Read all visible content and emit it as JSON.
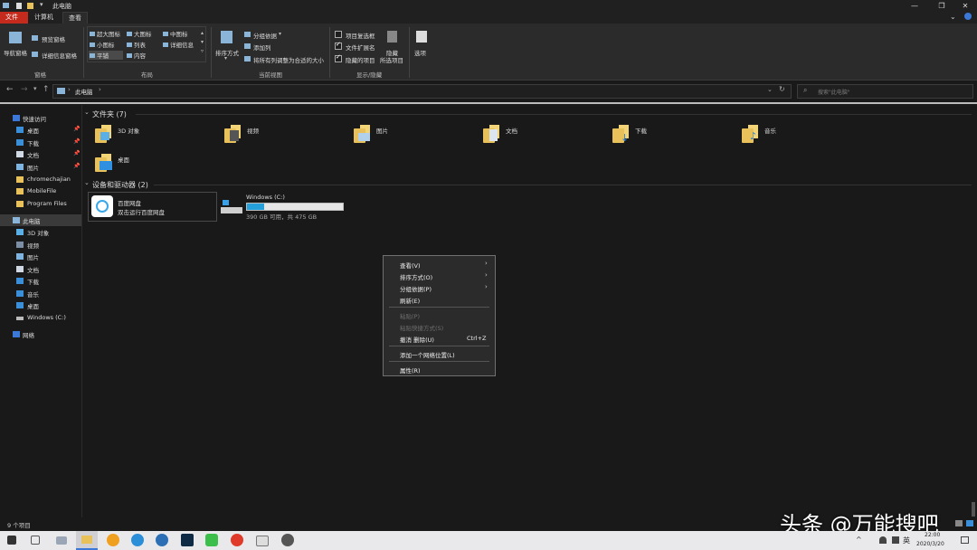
{
  "window": {
    "title": "此电脑"
  },
  "tabs": [
    "文件",
    "计算机",
    "查看"
  ],
  "ribbon": {
    "pane": {
      "nav_pane": "导航窗格",
      "preview": "预览窗格",
      "details": "详细信息窗格",
      "group": "窗格"
    },
    "layout": {
      "items": [
        "超大图标",
        "大图标",
        "中图标",
        "小图标",
        "列表",
        "详细信息",
        "平铺",
        "内容"
      ],
      "group": "布局"
    },
    "current_view": {
      "sort": "排序方式",
      "group_by": "分组依据",
      "add_col": "添加列",
      "fit_cols": "将所有列调整为合适的大小",
      "group": "当前视图"
    },
    "show_hide": {
      "item_cb": "项目复选框",
      "ext": "文件扩展名",
      "hidden": "隐藏的项目",
      "hide_sel": "隐藏",
      "hide_sel2": "所选项目",
      "group": "显示/隐藏"
    },
    "options": "选项"
  },
  "address": {
    "path": "此电脑",
    "search_placeholder": "搜索\"此电脑\""
  },
  "nav": {
    "quick_access": "快速访问",
    "quick_items": [
      "桌面",
      "下载",
      "文档",
      "图片",
      "chromechajian",
      "MobileFile",
      "Program Files"
    ],
    "this_pc": "此电脑",
    "pc_items": [
      "3D 对象",
      "视频",
      "图片",
      "文档",
      "下载",
      "音乐",
      "桌面",
      "Windows (C:)"
    ],
    "network": "网络"
  },
  "folders": {
    "header": "文件夹 (7)",
    "items": [
      "3D 对象",
      "视频",
      "图片",
      "文档",
      "下载",
      "音乐",
      "桌面"
    ]
  },
  "drives": {
    "header": "设备和驱动器 (2)",
    "baidu": {
      "name": "百度网盘",
      "desc": "双击运行百度网盘"
    },
    "c": {
      "name": "Windows (C:)",
      "info": "390 GB 可用，共 475 GB",
      "used_fraction": 0.18
    }
  },
  "context_menu": {
    "items": [
      "查看(V)",
      "排序方式(O)",
      "分组依据(P)",
      "刷新(E)",
      "粘贴(P)",
      "粘贴快捷方式(S)",
      "撤消 删除(U)",
      "添加一个网络位置(L)",
      "属性(R)"
    ],
    "shortcut": "Ctrl+Z"
  },
  "status": {
    "count": "9 个项目"
  },
  "taskbar": {
    "lang": "英",
    "time": "22:00",
    "date": "2020/3/20"
  },
  "watermark": "头条 @万能搜吧",
  "colors": {
    "accent": "#c42b1c",
    "drive_bar": "#26a0da"
  }
}
